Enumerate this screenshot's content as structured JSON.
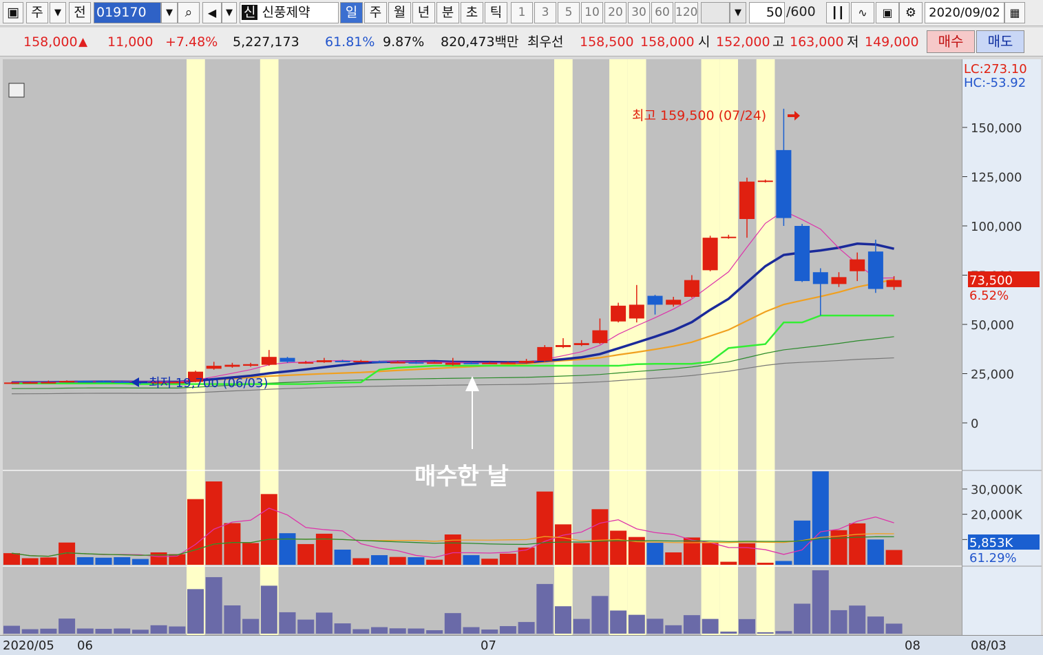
{
  "toolbar": {
    "market": "주",
    "prev": "전",
    "code": "019170",
    "badge": "신",
    "name": "신풍제약",
    "periods": [
      "일",
      "주",
      "월",
      "년",
      "분",
      "초",
      "틱"
    ],
    "intervals": [
      "1",
      "3",
      "5",
      "10",
      "20",
      "30",
      "60",
      "120"
    ],
    "count": "50",
    "count_max": "/600",
    "date": "2020/09/02"
  },
  "quote": {
    "price": "158,000",
    "change": "11,000",
    "change_pct": "+7.48%",
    "volume": "5,227,173",
    "vol_ratio": "61.81%",
    "turnover": "9.87%",
    "market_cap": "820,473백만",
    "best_label": "최우선",
    "best_ask": "158,500",
    "best_bid": "158,000",
    "open_label": "시",
    "open": "152,000",
    "high_label": "고",
    "high": "163,000",
    "low_label": "저",
    "low": "149,000",
    "buy": "매수",
    "sell": "매도"
  },
  "chart_data": {
    "type": "candlestick",
    "y_axis_ticks": [
      "150,000",
      "125,000",
      "100,000",
      "75,000",
      "50,000",
      "25,000",
      "0"
    ],
    "ylim": [
      0,
      160000
    ],
    "lc": "LC:273.10",
    "hc": "HC:-53.92",
    "current_price": "73,500",
    "current_pct": "6.52%",
    "high_note": "최고 159,500 (07/24)",
    "low_note": "최저 19,700 (06/03)",
    "annotation": "매수한 날",
    "volume_ticks": [
      "30,000K",
      "20,000K",
      "10,000K"
    ],
    "volume_current": "5,853K",
    "volume_pct": "61.29%",
    "dates": [
      "2020/05",
      "06",
      "07",
      "08",
      "08/03"
    ],
    "candles": [
      {
        "o": 20500,
        "c": 20500,
        "h": 20800,
        "l": 20000
      },
      {
        "o": 20500,
        "c": 20600,
        "h": 21000,
        "l": 20100
      },
      {
        "o": 20600,
        "c": 20700,
        "h": 21500,
        "l": 20300
      },
      {
        "o": 20700,
        "c": 21300,
        "h": 21600,
        "l": 20500
      },
      {
        "o": 21300,
        "c": 21200,
        "h": 21500,
        "l": 20800
      },
      {
        "o": 21200,
        "c": 21000,
        "h": 21400,
        "l": 20700
      },
      {
        "o": 21000,
        "c": 20800,
        "h": 21300,
        "l": 20500
      },
      {
        "o": 20800,
        "c": 20500,
        "h": 21000,
        "l": 19700
      },
      {
        "o": 20500,
        "c": 20700,
        "h": 21000,
        "l": 20200
      },
      {
        "o": 20700,
        "c": 20800,
        "h": 21100,
        "l": 20400
      },
      {
        "o": 20800,
        "c": 26000,
        "h": 26500,
        "l": 20600
      },
      {
        "o": 27500,
        "c": 29000,
        "h": 31000,
        "l": 27000
      },
      {
        "o": 28500,
        "c": 29500,
        "h": 30500,
        "l": 28000
      },
      {
        "o": 29000,
        "c": 29800,
        "h": 30500,
        "l": 28500
      },
      {
        "o": 29500,
        "c": 33500,
        "h": 37000,
        "l": 29000
      },
      {
        "o": 33000,
        "c": 31000,
        "h": 33500,
        "l": 30500
      },
      {
        "o": 30500,
        "c": 30800,
        "h": 31500,
        "l": 30000
      },
      {
        "o": 30800,
        "c": 31800,
        "h": 33000,
        "l": 30500
      },
      {
        "o": 31500,
        "c": 31300,
        "h": 32000,
        "l": 30800
      },
      {
        "o": 31300,
        "c": 31500,
        "h": 32000,
        "l": 31000
      },
      {
        "o": 31300,
        "c": 31000,
        "h": 31600,
        "l": 30500
      },
      {
        "o": 30800,
        "c": 30900,
        "h": 31400,
        "l": 30500
      },
      {
        "o": 30800,
        "c": 30500,
        "h": 31200,
        "l": 30000
      },
      {
        "o": 30500,
        "c": 30700,
        "h": 31000,
        "l": 30200
      },
      {
        "o": 29500,
        "c": 30500,
        "h": 33000,
        "l": 29000
      },
      {
        "o": 30500,
        "c": 30200,
        "h": 31000,
        "l": 29800
      },
      {
        "o": 30200,
        "c": 30500,
        "h": 31000,
        "l": 30000
      },
      {
        "o": 30300,
        "c": 30600,
        "h": 31000,
        "l": 30000
      },
      {
        "o": 30500,
        "c": 31500,
        "h": 32500,
        "l": 30000
      },
      {
        "o": 31500,
        "c": 38500,
        "h": 39500,
        "l": 31000
      },
      {
        "o": 38500,
        "c": 39500,
        "h": 43000,
        "l": 38000
      },
      {
        "o": 39500,
        "c": 40500,
        "h": 42000,
        "l": 39000
      },
      {
        "o": 40500,
        "c": 47000,
        "h": 53000,
        "l": 40000
      },
      {
        "o": 51500,
        "c": 59500,
        "h": 61000,
        "l": 51000
      },
      {
        "o": 53000,
        "c": 60000,
        "h": 70000,
        "l": 51000
      },
      {
        "o": 64500,
        "c": 60000,
        "h": 65000,
        "l": 55000
      },
      {
        "o": 60000,
        "c": 62500,
        "h": 64000,
        "l": 59000
      },
      {
        "o": 64000,
        "c": 72500,
        "h": 75000,
        "l": 63500
      },
      {
        "o": 77500,
        "c": 94000,
        "h": 95000,
        "l": 77000
      },
      {
        "o": 94000,
        "c": 94500,
        "h": 95500,
        "l": 93500
      },
      {
        "o": 103500,
        "c": 122500,
        "h": 124500,
        "l": 94000
      },
      {
        "o": 122500,
        "c": 123000,
        "h": 123500,
        "l": 122000
      },
      {
        "o": 138500,
        "c": 104000,
        "h": 159500,
        "l": 100000
      },
      {
        "o": 100000,
        "c": 72000,
        "h": 101000,
        "l": 71500
      },
      {
        "o": 76500,
        "c": 70500,
        "h": 78500,
        "l": 54500
      },
      {
        "o": 70500,
        "c": 74000,
        "h": 76500,
        "l": 69000
      },
      {
        "o": 77000,
        "c": 83000,
        "h": 86500,
        "l": 72000
      },
      {
        "o": 87000,
        "c": 68000,
        "h": 93000,
        "l": 66000
      },
      {
        "o": 69000,
        "c": 72500,
        "h": 74500,
        "l": 67500
      }
    ],
    "volume_k": [
      4600,
      2600,
      2900,
      8800,
      3000,
      2800,
      3000,
      2300,
      4900,
      4200,
      26000,
      33000,
      16500,
      8600,
      28000,
      12500,
      8200,
      12300,
      6000,
      2600,
      3800,
      3100,
      3000,
      2000,
      12000,
      3800,
      2400,
      4400,
      6800,
      29000,
      16000,
      8600,
      22000,
      13500,
      11000,
      8700,
      4900,
      10800,
      8600,
      1200,
      8500,
      800,
      1500,
      17500,
      37000,
      13700,
      16400,
      10000,
      5853
    ]
  }
}
